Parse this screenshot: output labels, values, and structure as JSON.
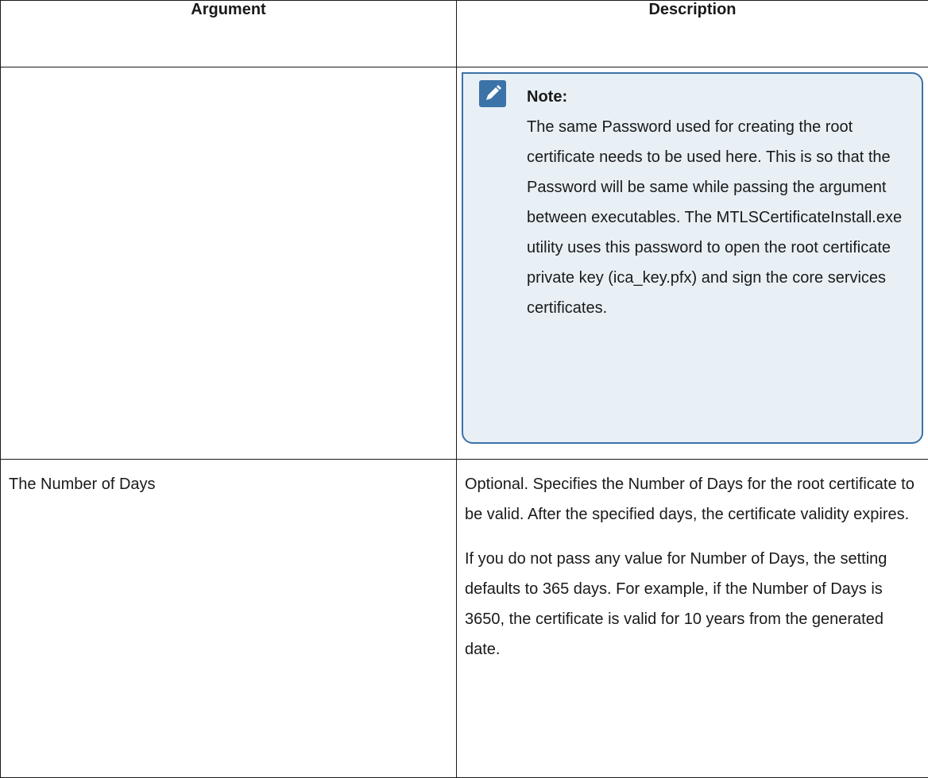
{
  "table": {
    "header": {
      "argument": "Argument",
      "description": "Description"
    },
    "rows": [
      {
        "argument": "",
        "note": {
          "icon": "pencil-icon",
          "label": "Note:",
          "text": "The same Password used for creating the root certificate needs to be used here. This is so that the Password will be same while passing the argument between executables. The MTLSCertificateInstall.exe utility uses this password to open the root certificate private key (ica_key.pfx) and sign the core services certificates."
        }
      },
      {
        "argument": "The Number of Days",
        "paragraphs": [
          "Optional. Specifies the Number of Days for the root certificate to be valid. After the specified days, the certificate validity expires.",
          "If you do not pass any value for Number of Days, the setting defaults to 365 days. For example, if the Number of Days is 3650, the certificate is valid for 10 years from the generated date."
        ]
      }
    ]
  },
  "colors": {
    "note_background": "#e8f0f6",
    "note_border": "#3b72a8",
    "text": "#1a1a1a"
  }
}
